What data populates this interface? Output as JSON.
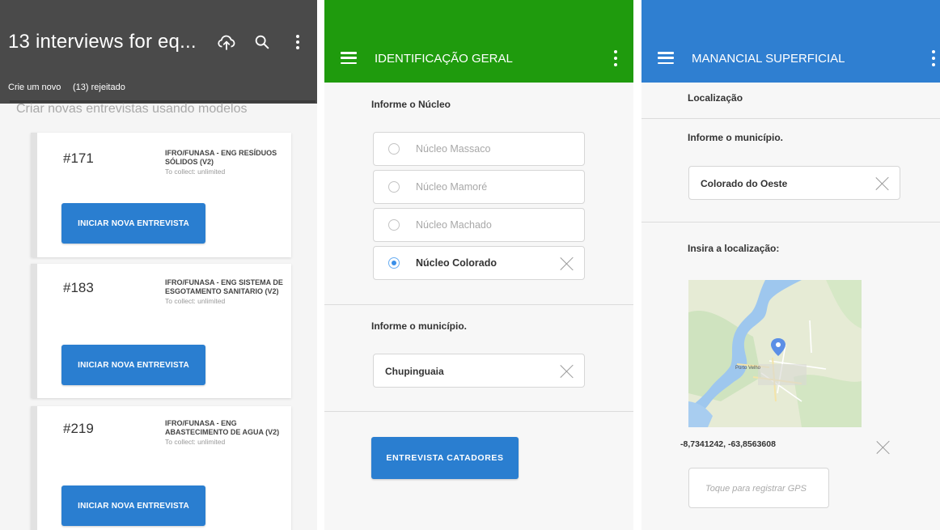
{
  "panel1": {
    "app_title": "13 interviews for eq...",
    "icons": {
      "upload": "cloud-upload-icon",
      "search": "search-icon",
      "more": "more-vert-icon"
    },
    "tabs": [
      "Crie um novo",
      "(13) rejeitado"
    ],
    "subheading": "Criar novas entrevistas usando modelos",
    "cards": [
      {
        "number": "#171",
        "title": "IFRO/FUNASA - ENG RESÍDUOS SÓLIDOS (v2)",
        "collect": "To collect: unlimited",
        "button": "INICIAR NOVA ENTREVISTA"
      },
      {
        "number": "#183",
        "title": "IFRO/FUNASA - ENG SISTEMA DE ESGOTAMENTO SANITARIO (v2)",
        "collect": "To collect: unlimited",
        "button": "INICIAR NOVA ENTREVISTA"
      },
      {
        "number": "#219",
        "title": "IFRO/FUNASA - ENG ABASTECIMENTO DE AGUA (v2)",
        "collect": "To collect: unlimited",
        "button": "INICIAR NOVA ENTREVISTA"
      }
    ]
  },
  "panel2": {
    "title": "IDENTIFICAÇÃO GERAL",
    "color": "#1f9b0d",
    "question1": "Informe o Núcleo",
    "options": [
      {
        "label": "Núcleo Massaco",
        "selected": false
      },
      {
        "label": "Núcleo Mamoré",
        "selected": false
      },
      {
        "label": "Núcleo Machado",
        "selected": false
      },
      {
        "label": "Núcleo Colorado",
        "selected": true
      }
    ],
    "question2": "Informe o município.",
    "municipio_value": "Chupinguaia",
    "action_button": "ENTREVISTA CATADORES"
  },
  "panel3": {
    "title": "MANANCIAL SUPERFICIAL",
    "color": "#2f7fd1",
    "section": "Localização",
    "question_municipio": "Informe o município.",
    "municipio_value": "Colorado do Oeste",
    "question_location": "Insira a localização:",
    "map_label": "Porto Velho",
    "coordinates": "-8,7341242, -63,8563608",
    "gps_placeholder": "Toque para registrar GPS"
  }
}
